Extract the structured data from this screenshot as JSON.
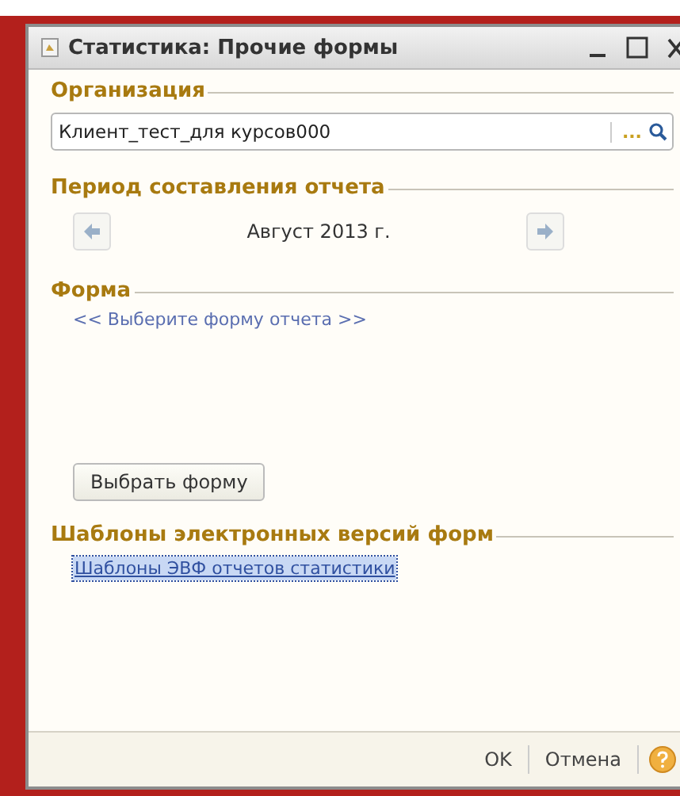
{
  "window": {
    "title": "Статистика: Прочие формы"
  },
  "organization": {
    "label": "Организация",
    "value": "Клиент_тест_для курсов000",
    "select_button": "..."
  },
  "period": {
    "label": "Период составления отчета",
    "value": "Август 2013 г."
  },
  "form": {
    "label": "Форма",
    "link": "<< Выберите форму отчета >>",
    "button": "Выбрать форму"
  },
  "templates": {
    "label": "Шаблоны электронных версий форм",
    "link": "Шаблоны ЭВФ отчетов статистики",
    "selected": true
  },
  "footer": {
    "buttons": [
      "OK",
      "Отмена"
    ]
  }
}
